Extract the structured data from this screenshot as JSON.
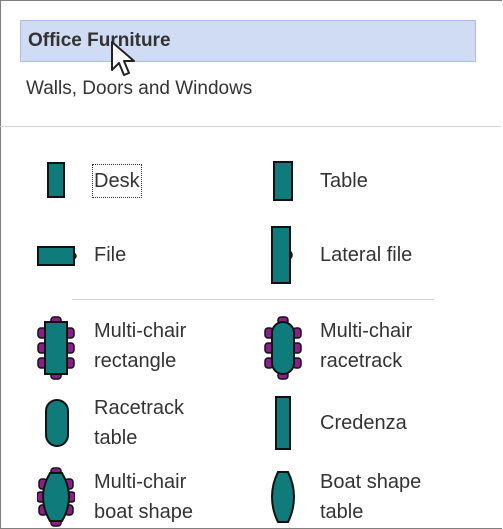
{
  "panel": {
    "active_stencil": "Office Furniture",
    "other_stencil": "Walls, Doors and Windows"
  },
  "shapes": [
    {
      "id": "desk",
      "label": "Desk",
      "icon": "desk-icon"
    },
    {
      "id": "table",
      "label": "Table",
      "icon": "table-icon"
    },
    {
      "id": "file",
      "label": "File",
      "icon": "file-icon"
    },
    {
      "id": "lateral-file",
      "label": "Lateral file",
      "icon": "lateral-file-icon"
    },
    {
      "id": "multi-chair-rectangle",
      "label_lines": [
        "Multi-chair",
        "rectangle"
      ],
      "icon": "multi-chair-rectangle-icon"
    },
    {
      "id": "multi-chair-racetrack",
      "label_lines": [
        "Multi-chair",
        "racetrack"
      ],
      "icon": "multi-chair-racetrack-icon"
    },
    {
      "id": "racetrack-table",
      "label_lines": [
        "Racetrack",
        "table"
      ],
      "icon": "racetrack-table-icon"
    },
    {
      "id": "credenza",
      "label": "Credenza",
      "icon": "credenza-icon"
    },
    {
      "id": "multi-chair-boat-shape",
      "label_lines": [
        "Multi-chair",
        "boat shape"
      ],
      "icon": "multi-chair-boat-shape-icon"
    },
    {
      "id": "boat-shape-table",
      "label_lines": [
        "Boat shape",
        "table"
      ],
      "icon": "boat-shape-table-icon"
    }
  ],
  "colors": {
    "shape_fill": "#0f7b7b",
    "shape_stroke": "#111111",
    "chair_fill": "#8a1f8a",
    "header_bg": "#cfdcf3"
  }
}
